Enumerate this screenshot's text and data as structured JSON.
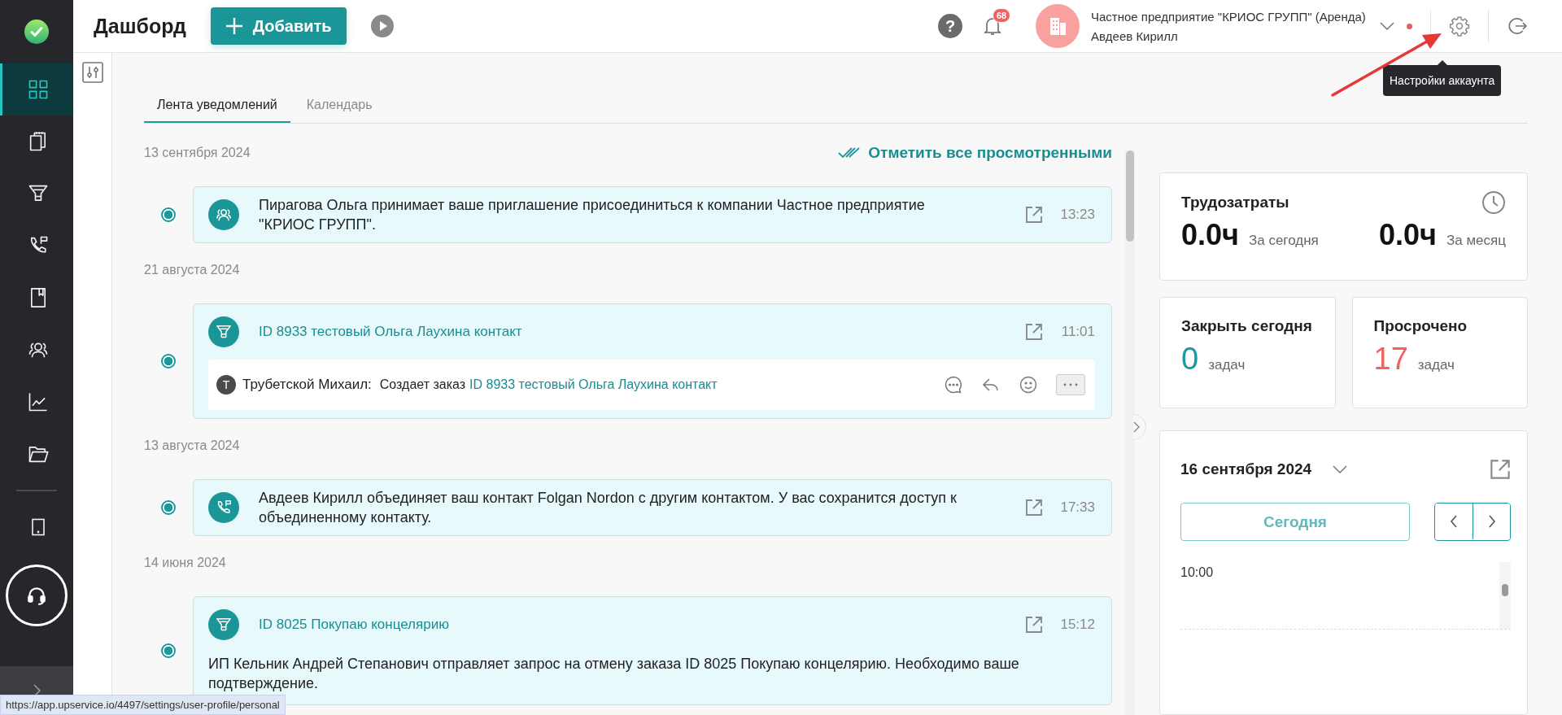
{
  "header": {
    "title": "Дашборд",
    "add_button": "Добавить",
    "help": "?",
    "notifications": "68",
    "company": "Частное предприятие \"КРИОС ГРУПП\" (Аренда)",
    "user": "Авдеев Кирилл"
  },
  "tooltip": "Настройки аккаунта",
  "sidebar": {
    "items": [
      {
        "selected": true
      },
      {
        "selected": false
      },
      {
        "selected": false
      },
      {
        "selected": false
      },
      {
        "selected": false
      },
      {
        "selected": false
      },
      {
        "selected": false
      },
      {
        "selected": false
      }
    ]
  },
  "tabs": [
    {
      "label": "Лента уведомлений",
      "selected": true
    },
    {
      "label": "Календарь",
      "selected": false
    }
  ],
  "mark_all": "Отметить все просмотренными",
  "feed": [
    {
      "date": "13 сентября 2024",
      "items": [
        {
          "kind": "invite",
          "text": "Пирагова Ольга принимает ваше приглашение присоединиться к компании Частное предприятие \"КРИОС ГРУПП\".",
          "time": "13:23",
          "unread": true
        }
      ]
    },
    {
      "date": "21 августа 2024",
      "items": [
        {
          "kind": "order",
          "title": "ID 8933 тестовый Ольга Лаухина контакт",
          "time": "11:01",
          "unread": true,
          "comment": {
            "avatar": "Т",
            "author": "Трубетской Михаил:",
            "text": "Создает заказ",
            "link": "ID 8933 тестовый Ольга Лаухина контакт"
          }
        }
      ]
    },
    {
      "date": "13 августа 2024",
      "items": [
        {
          "kind": "merge",
          "text": "Авдеев Кирилл объединяет ваш контакт Folgan Nordon с другим контактом. У вас сохранится доступ к объединенному контакту.",
          "time": "17:33",
          "unread": true
        }
      ]
    },
    {
      "date": "14 июня 2024",
      "items": [
        {
          "kind": "order",
          "title": "ID 8025 Покупаю концелярию",
          "time": "15:12",
          "unread": true,
          "body": "ИП Кельник Андрей Степанович отправляет запрос на отмену заказа ID 8025 Покупаю концелярию. Необходимо ваше подтверждение."
        }
      ]
    }
  ],
  "labor": {
    "title": "Трудозатраты",
    "today_value": "0.0ч",
    "today_label": "За сегодня",
    "month_value": "0.0ч",
    "month_label": "За месяц"
  },
  "tasks": [
    {
      "title": "Закрыть сегодня",
      "value": "0",
      "unit": "задач",
      "color": "#1a9a9e"
    },
    {
      "title": "Просрочено",
      "value": "17",
      "unit": "задач",
      "color": "#f0625f"
    }
  ],
  "calendar": {
    "date": "16 сентября 2024",
    "today_button": "Сегодня",
    "times": [
      "10:00"
    ]
  },
  "status_url": "https://app.upservice.io/4497/settings/user-profile/personal"
}
